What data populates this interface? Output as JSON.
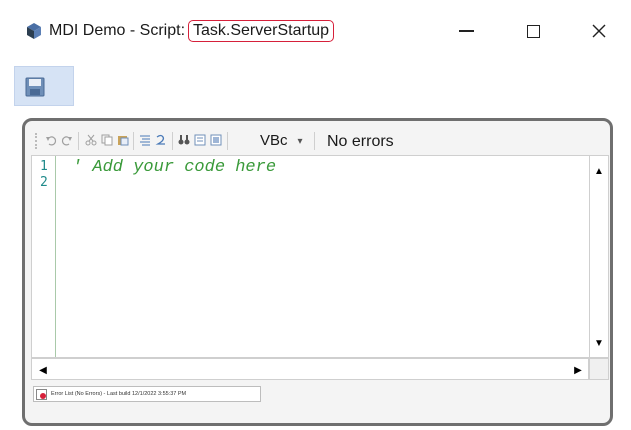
{
  "window": {
    "title_prefix": "MDI Demo - Script:",
    "title_script": "Task.ServerStartup",
    "minimize_label": "Minimize",
    "maximize_label": "Maximize",
    "close_label": "Close"
  },
  "editor": {
    "language": "VBc",
    "status": "No errors",
    "line_numbers": [
      "1",
      "2"
    ],
    "lines": [
      "' Add your code here",
      ""
    ]
  },
  "error_list": {
    "tab_label": "Error List (No Errors) - Last build 12/1/2022 3:55:37 PM"
  },
  "colors": {
    "highlight_border": "#d6203a",
    "comment_text": "#3a9a3a",
    "line_number": "#1f8a8a",
    "toolbar_bg": "#d6e3f5"
  }
}
